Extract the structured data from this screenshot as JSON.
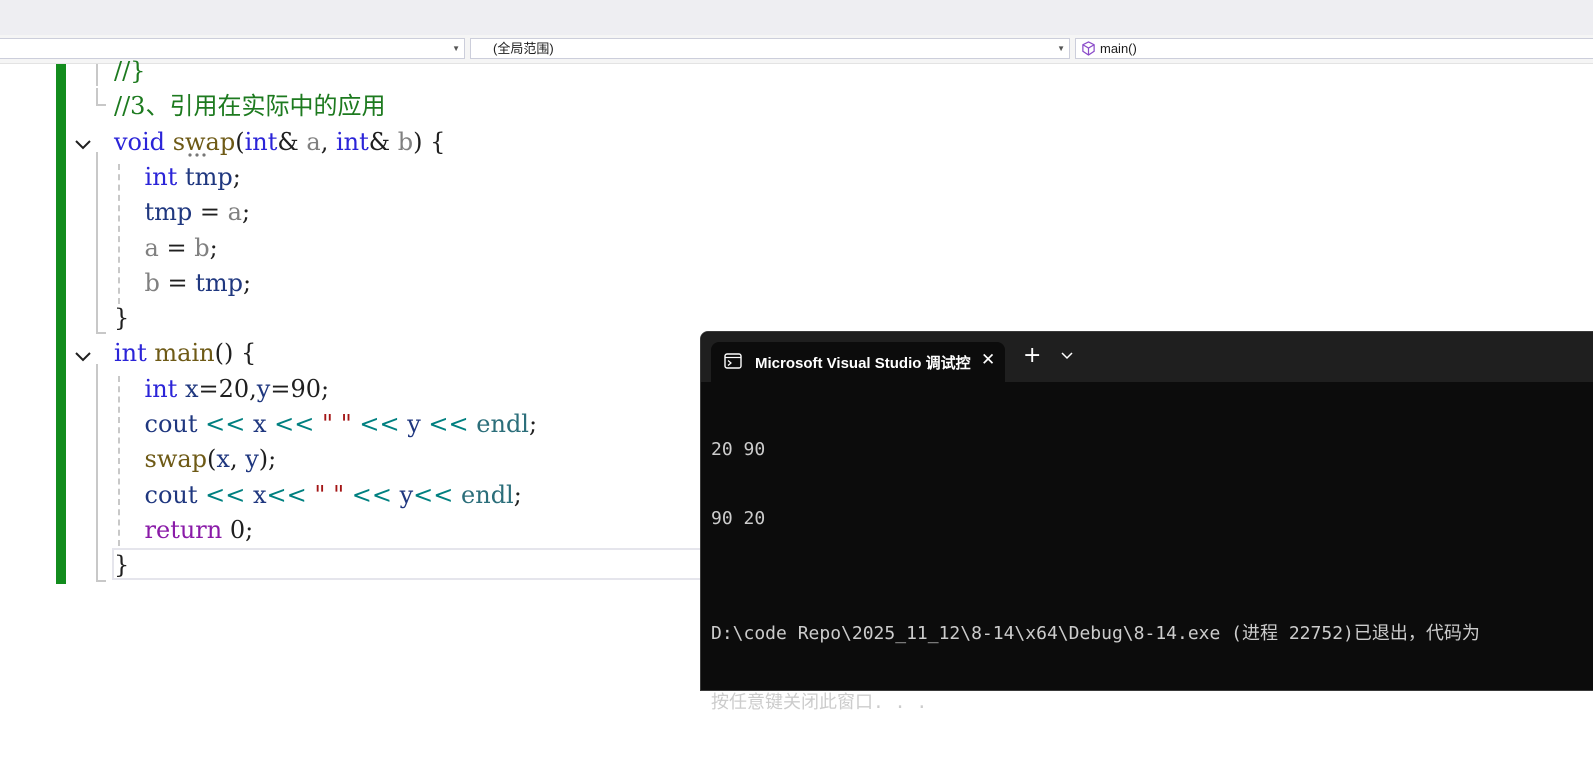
{
  "navbar": {
    "project_dropdown": "",
    "scope_dropdown": "(全局范围)",
    "member_dropdown": "main()"
  },
  "editor": {
    "lines": [
      {
        "tokens": [
          {
            "t": "//}",
            "c": "cmt"
          }
        ]
      },
      {
        "tokens": [
          {
            "t": "//3、引用在实际中的应用",
            "c": "cmt"
          }
        ]
      },
      {
        "tokens": [
          {
            "t": "void",
            "c": "kw"
          },
          {
            "t": " ",
            "c": "pun"
          },
          {
            "t": "swap",
            "c": "fn"
          },
          {
            "t": "(",
            "c": "pun"
          },
          {
            "t": "int",
            "c": "kw"
          },
          {
            "t": "& ",
            "c": "pun"
          },
          {
            "t": "a",
            "c": "prm"
          },
          {
            "t": ", ",
            "c": "pun"
          },
          {
            "t": "int",
            "c": "kw"
          },
          {
            "t": "& ",
            "c": "pun"
          },
          {
            "t": "b",
            "c": "prm"
          },
          {
            "t": ") {",
            "c": "pun"
          }
        ]
      },
      {
        "tokens": [
          {
            "t": "    ",
            "c": "pun"
          },
          {
            "t": "int",
            "c": "kw"
          },
          {
            "t": " ",
            "c": "pun"
          },
          {
            "t": "tmp",
            "c": "var"
          },
          {
            "t": ";",
            "c": "pun"
          }
        ]
      },
      {
        "tokens": [
          {
            "t": "    ",
            "c": "pun"
          },
          {
            "t": "tmp",
            "c": "var"
          },
          {
            "t": " = ",
            "c": "pun"
          },
          {
            "t": "a",
            "c": "prm"
          },
          {
            "t": ";",
            "c": "pun"
          }
        ]
      },
      {
        "tokens": [
          {
            "t": "    ",
            "c": "pun"
          },
          {
            "t": "a",
            "c": "prm"
          },
          {
            "t": " = ",
            "c": "pun"
          },
          {
            "t": "b",
            "c": "prm"
          },
          {
            "t": ";",
            "c": "pun"
          }
        ]
      },
      {
        "tokens": [
          {
            "t": "    ",
            "c": "pun"
          },
          {
            "t": "b",
            "c": "prm"
          },
          {
            "t": " = ",
            "c": "pun"
          },
          {
            "t": "tmp",
            "c": "var"
          },
          {
            "t": ";",
            "c": "pun"
          }
        ]
      },
      {
        "tokens": [
          {
            "t": "}",
            "c": "pun"
          }
        ]
      },
      {
        "tokens": [
          {
            "t": "int",
            "c": "kw"
          },
          {
            "t": " ",
            "c": "pun"
          },
          {
            "t": "main",
            "c": "fn"
          },
          {
            "t": "() {",
            "c": "pun"
          }
        ]
      },
      {
        "tokens": [
          {
            "t": "    ",
            "c": "pun"
          },
          {
            "t": "int",
            "c": "kw"
          },
          {
            "t": " ",
            "c": "pun"
          },
          {
            "t": "x",
            "c": "var"
          },
          {
            "t": "=20,",
            "c": "pun"
          },
          {
            "t": "y",
            "c": "var"
          },
          {
            "t": "=90;",
            "c": "pun"
          }
        ]
      },
      {
        "tokens": [
          {
            "t": "    ",
            "c": "pun"
          },
          {
            "t": "cout",
            "c": "var"
          },
          {
            "t": " << ",
            "c": "op"
          },
          {
            "t": "x",
            "c": "var"
          },
          {
            "t": " << ",
            "c": "op"
          },
          {
            "t": "\" \"",
            "c": "str"
          },
          {
            "t": " << ",
            "c": "op"
          },
          {
            "t": "y",
            "c": "var"
          },
          {
            "t": " << ",
            "c": "op"
          },
          {
            "t": "endl",
            "c": "obj"
          },
          {
            "t": ";",
            "c": "pun"
          }
        ]
      },
      {
        "tokens": [
          {
            "t": "    ",
            "c": "pun"
          },
          {
            "t": "swap",
            "c": "fn"
          },
          {
            "t": "(",
            "c": "pun"
          },
          {
            "t": "x",
            "c": "var"
          },
          {
            "t": ", ",
            "c": "pun"
          },
          {
            "t": "y",
            "c": "var"
          },
          {
            "t": ");",
            "c": "pun"
          }
        ]
      },
      {
        "tokens": [
          {
            "t": "    ",
            "c": "pun"
          },
          {
            "t": "cout",
            "c": "var"
          },
          {
            "t": " << ",
            "c": "op"
          },
          {
            "t": "x",
            "c": "var"
          },
          {
            "t": "<< ",
            "c": "op"
          },
          {
            "t": "\" \"",
            "c": "str"
          },
          {
            "t": " << ",
            "c": "op"
          },
          {
            "t": "y",
            "c": "var"
          },
          {
            "t": "<< ",
            "c": "op"
          },
          {
            "t": "endl",
            "c": "obj"
          },
          {
            "t": ";",
            "c": "pun"
          }
        ]
      },
      {
        "tokens": [
          {
            "t": "    ",
            "c": "pun"
          },
          {
            "t": "return",
            "c": "kw2"
          },
          {
            "t": " 0;",
            "c": "pun"
          }
        ]
      },
      {
        "tokens": [
          {
            "t": "}",
            "c": "pun"
          }
        ]
      }
    ]
  },
  "console": {
    "tab_title": "Microsoft Visual Studio 调试控",
    "output": [
      "20 90",
      "90 20",
      "",
      "D:\\code Repo\\2025_11_12\\8-14\\x64\\Debug\\8-14.exe (进程 22752)已退出，代码为",
      "按任意键关闭此窗口. . ."
    ]
  },
  "colors": {
    "comment": "#1d7a1f",
    "keyword": "#2b24d8",
    "return_keyword": "#8a1ba8",
    "function": "#6e5a16",
    "parameter": "#808080",
    "variable": "#1f377f",
    "operator": "#008080",
    "string": "#a31515",
    "change_bar": "#128c1d",
    "console_bg": "#0c0c0c"
  },
  "icons": {
    "member_icon": "cube-icon",
    "console_tab_icon": "terminal-icon"
  }
}
